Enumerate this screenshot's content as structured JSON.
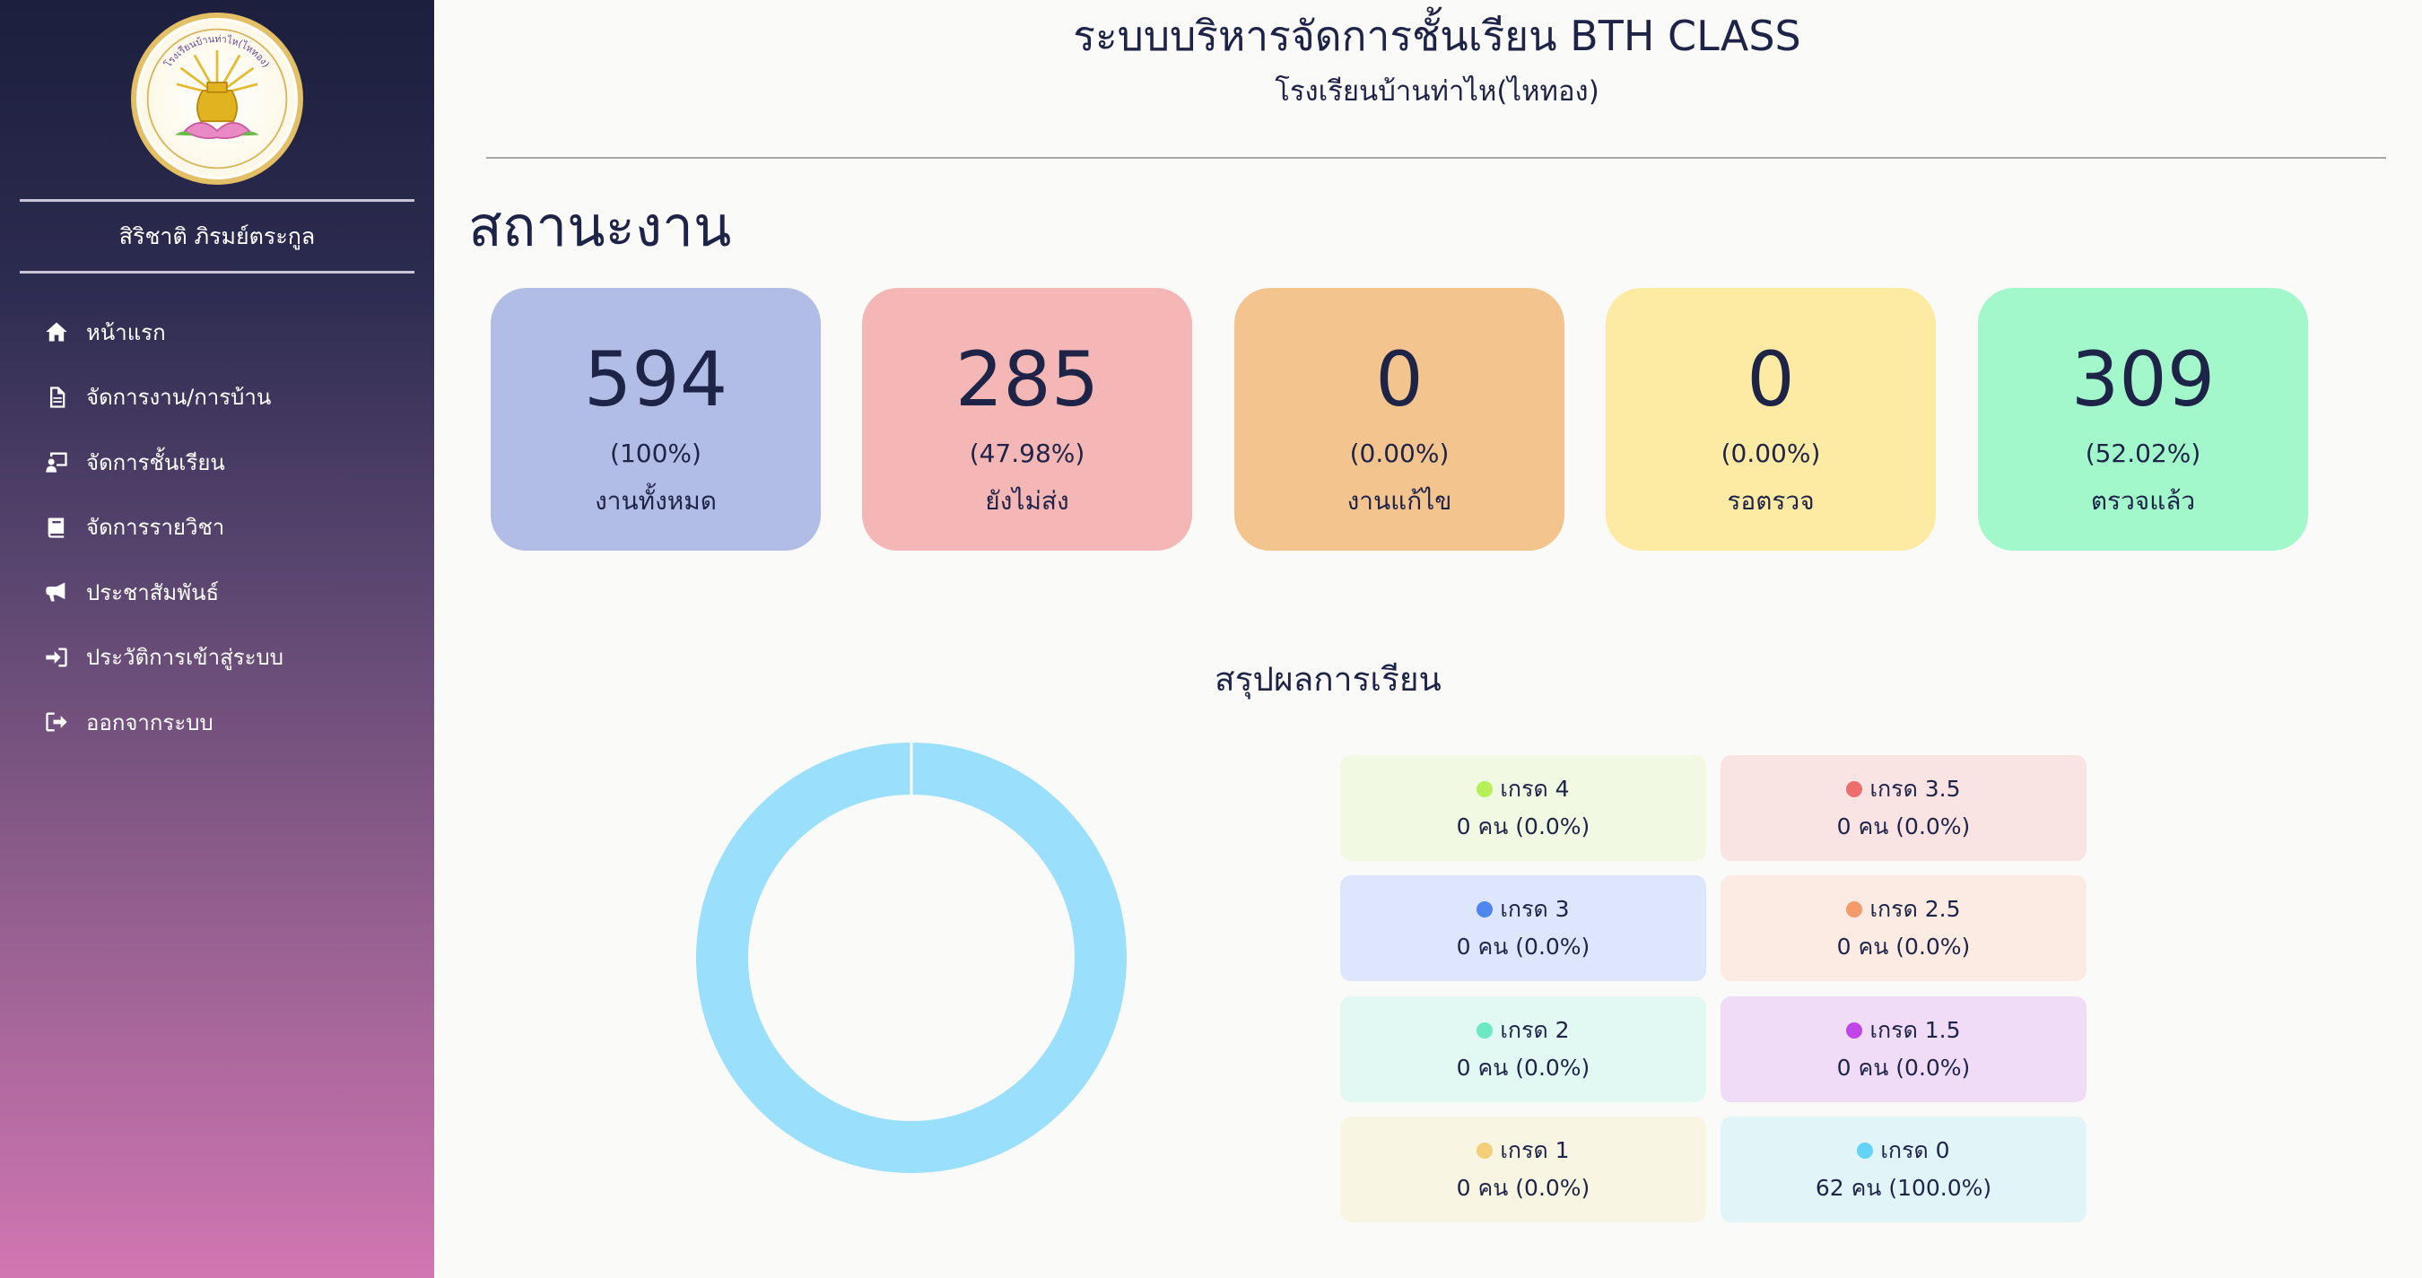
{
  "sidebar": {
    "logo_text": "โรงเรียนบ้านท่าไห(ไหทอง)",
    "user_name": "สิริชาติ ภิรมย์ตระกูล",
    "menu": [
      {
        "label": "หน้าแรก",
        "icon": "home-icon"
      },
      {
        "label": "จัดการงาน/การบ้าน",
        "icon": "document-icon"
      },
      {
        "label": "จัดการชั้นเรียน",
        "icon": "classroom-icon"
      },
      {
        "label": "จัดการรายวิชา",
        "icon": "book-icon"
      },
      {
        "label": "ประชาสัมพันธ์",
        "icon": "megaphone-icon"
      },
      {
        "label": "ประวัติการเข้าสู่ระบบ",
        "icon": "sign-in-icon"
      },
      {
        "label": "ออกจากระบบ",
        "icon": "sign-out-icon"
      }
    ]
  },
  "header": {
    "title": "ระบบบริหารจัดการชั้นเรียน BTH CLASS",
    "school": "โรงเรียนบ้านท่าไห(ไหทอง)"
  },
  "status": {
    "title": "สถานะงาน",
    "cards": [
      {
        "value": "594",
        "percent": "(100%)",
        "label": "งานทั้งหมด",
        "color": "#b2bde6"
      },
      {
        "value": "285",
        "percent": "(47.98%)",
        "label": "ยังไม่ส่ง",
        "color": "#f5b6b6"
      },
      {
        "value": "0",
        "percent": "(0.00%)",
        "label": "งานแก้ไข",
        "color": "#f4c48e"
      },
      {
        "value": "0",
        "percent": "(0.00%)",
        "label": "รอตรวจ",
        "color": "#fdeba3"
      },
      {
        "value": "309",
        "percent": "(52.02%)",
        "label": "ตรวจแล้ว",
        "color": "#a2f7cb"
      }
    ]
  },
  "summary": {
    "title": "สรุปผลการเรียน",
    "grades": [
      {
        "name": "เกรด 4",
        "count": "0 คน (0.0%)",
        "students": 0,
        "dot": "#b5f05a",
        "bg": "#f1f9e2"
      },
      {
        "name": "เกรด 3.5",
        "count": "0 คน (0.0%)",
        "students": 0,
        "dot": "#ee6e6e",
        "bg": "#f9e3e3"
      },
      {
        "name": "เกรด 3",
        "count": "0 คน (0.0%)",
        "students": 0,
        "dot": "#4f86f0",
        "bg": "#dde6fd"
      },
      {
        "name": "เกรด 2.5",
        "count": "0 คน (0.0%)",
        "students": 0,
        "dot": "#f59a6a",
        "bg": "#fbebe2"
      },
      {
        "name": "เกรด 2",
        "count": "0 คน (0.0%)",
        "students": 0,
        "dot": "#6ce9c2",
        "bg": "#e1f8f3"
      },
      {
        "name": "เกรด 1.5",
        "count": "0 คน (0.0%)",
        "students": 0,
        "dot": "#c146e8",
        "bg": "#f1dcf7"
      },
      {
        "name": "เกรด 1",
        "count": "0 คน (0.0%)",
        "students": 0,
        "dot": "#f3cf78",
        "bg": "#f8f5e2"
      },
      {
        "name": "เกรด 0",
        "count": "62 คน (100.0%)",
        "students": 62,
        "dot": "#63d4f8",
        "bg": "#e1f4f8"
      }
    ],
    "donut_color": "#9adffb"
  }
}
